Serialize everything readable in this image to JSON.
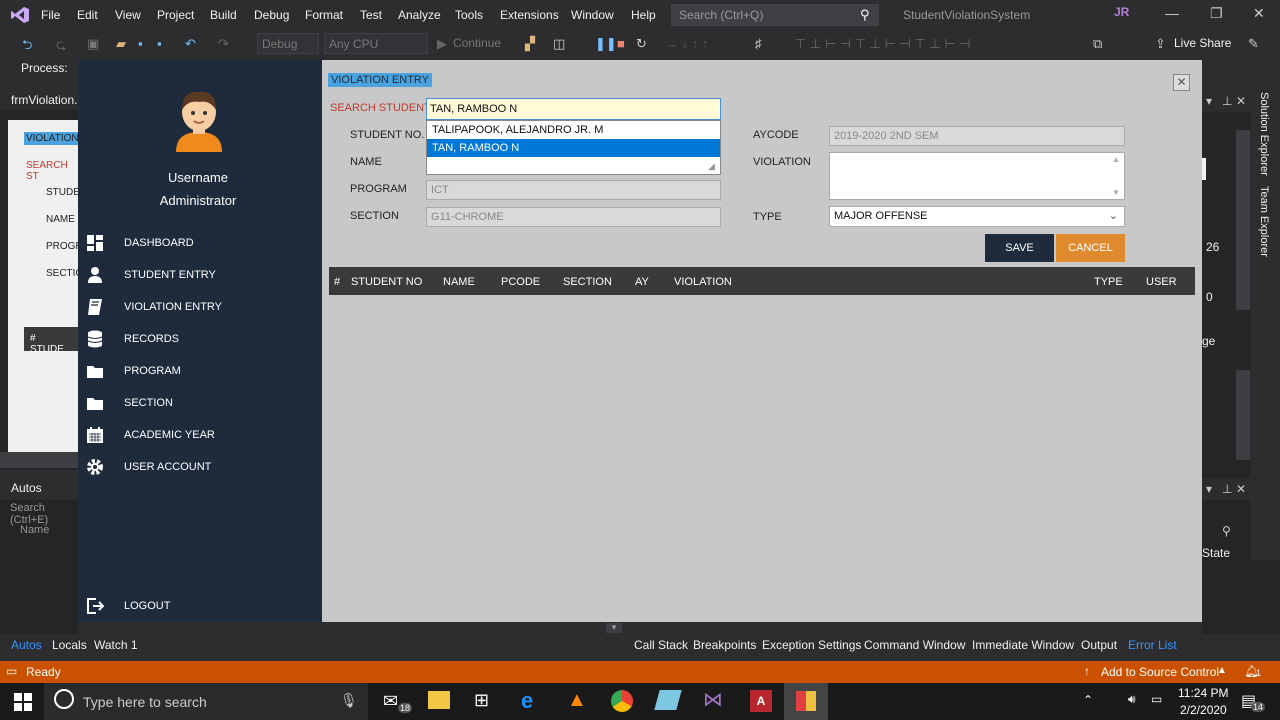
{
  "vs": {
    "menu": [
      "File",
      "Edit",
      "View",
      "Project",
      "Build",
      "Debug",
      "Format",
      "Test",
      "Analyze",
      "Tools",
      "Extensions",
      "Window",
      "Help"
    ],
    "search_placeholder": "Search (Ctrl+Q)",
    "solution": "StudentViolationSystem",
    "user_initials": "JR",
    "config": "Debug",
    "platform": "Any CPU",
    "continue": "Continue",
    "live_share": "Live Share",
    "process_label": "Process:",
    "doc_tab": "frmViolation.",
    "autos_title": "Autos",
    "autos_search": "Search (Ctrl+E)",
    "autos_col": "Name",
    "designer": {
      "header": "VIOLATION",
      "search": "SEARCH ST",
      "labels": [
        "STUDE",
        "NAME",
        "PROGR",
        "SECTIO"
      ],
      "grid": "#   STUDE"
    },
    "right": {
      "tab1": "Solution Explorer",
      "tab2": "Team Explorer",
      "val1": "26",
      "val2": "0",
      "label": "ge",
      "state": "State"
    },
    "bottom_left": [
      "Autos",
      "Locals",
      "Watch 1"
    ],
    "bottom_right": [
      "Call Stack",
      "Breakpoints",
      "Exception Settings",
      "Command Window",
      "Immediate Window",
      "Output",
      "Error List"
    ],
    "status": "Ready",
    "source_control": "Add to Source Control",
    "notif": "1"
  },
  "taskbar": {
    "search": "Type here to search",
    "time": "11:24 PM",
    "date": "2/2/2020",
    "mail_count": "18",
    "notif_count": "14"
  },
  "app": {
    "username": "Username",
    "role": "Administrator",
    "menu": [
      "DASHBOARD",
      "STUDENT ENTRY",
      "VIOLATION ENTRY",
      "RECORDS",
      "PROGRAM",
      "SECTION",
      "ACADEMIC YEAR",
      "USER ACCOUNT"
    ],
    "logout": "LOGOUT",
    "title": "VIOLATION ENTRY",
    "search_label": "SEARCH STUDENT",
    "search_value": "TAN, RAMBOO N",
    "suggestions": [
      "TALIPAPOOK, ALEJANDRO JR. M",
      "TAN, RAMBOO N"
    ],
    "labels": {
      "student_no": "STUDENT NO.",
      "name": "NAME",
      "program": "PROGRAM",
      "section": "SECTION",
      "aycode": "AYCODE",
      "violation": "VIOLATION",
      "type": "TYPE"
    },
    "values": {
      "program": "ICT",
      "section": "G11-CHROME",
      "aycode": "2019-2020 2ND SEM",
      "type": "MAJOR OFFENSE"
    },
    "save": "SAVE",
    "cancel": "CANCEL",
    "columns": [
      "#",
      "STUDENT NO",
      "NAME",
      "PCODE",
      "SECTION",
      "AY",
      "VIOLATION",
      "TYPE",
      "USER"
    ]
  },
  "colors": {
    "accent_orange": "#e08a2e",
    "sidebar": "#1e2b3c",
    "save_btn": "#1e2b3c",
    "highlight": "#0078d7"
  }
}
